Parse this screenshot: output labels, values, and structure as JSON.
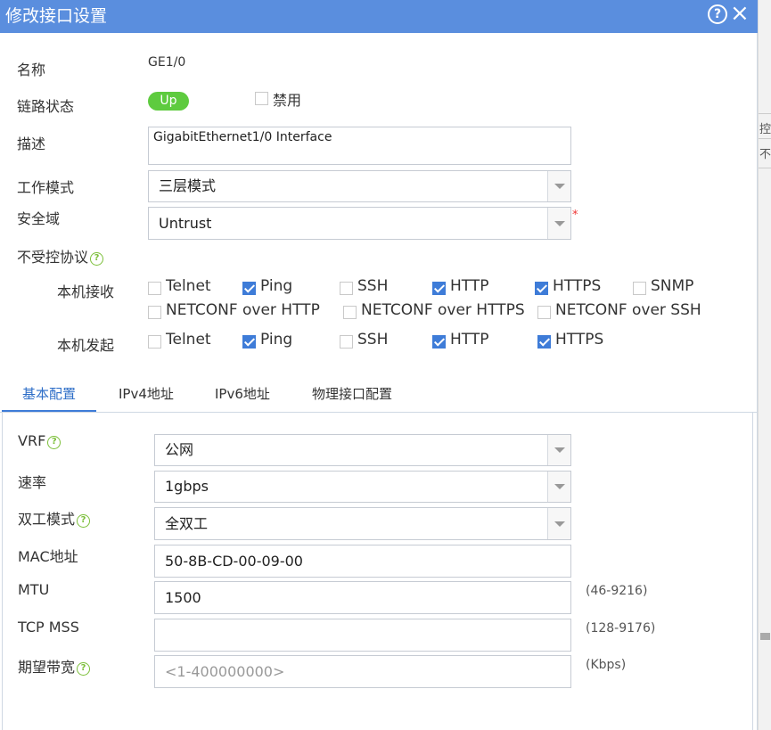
{
  "dialog": {
    "title": "修改接口设置",
    "help_icon": "question-circle-icon",
    "close_icon": "close-icon"
  },
  "background": {
    "fragment1": "控制",
    "fragment2": "不"
  },
  "form": {
    "name_label": "名称",
    "name_value": "GE1/0",
    "link_status_label": "链路状态",
    "link_status_value": "Up",
    "disable_label": "禁用",
    "disable_checked": false,
    "desc_label": "描述",
    "desc_value": "GigabitEthernet1/0 Interface",
    "work_mode_label": "工作模式",
    "work_mode_value": "三层模式",
    "security_zone_label": "安全域",
    "security_zone_value": "Untrust",
    "required_mark": "*",
    "uncontrolled_label": "不受控协议",
    "local_receive_label": "本机接收",
    "local_send_label": "本机发起",
    "receive": [
      {
        "label": "Telnet",
        "checked": false
      },
      {
        "label": "Ping",
        "checked": true
      },
      {
        "label": "SSH",
        "checked": false
      },
      {
        "label": "HTTP",
        "checked": true
      },
      {
        "label": "HTTPS",
        "checked": true
      },
      {
        "label": "SNMP",
        "checked": false
      },
      {
        "label": "NETCONF over HTTP",
        "checked": false
      },
      {
        "label": "NETCONF over HTTPS",
        "checked": false
      },
      {
        "label": "NETCONF over SSH",
        "checked": false
      }
    ],
    "send": [
      {
        "label": "Telnet",
        "checked": false
      },
      {
        "label": "Ping",
        "checked": true
      },
      {
        "label": "SSH",
        "checked": false
      },
      {
        "label": "HTTP",
        "checked": true
      },
      {
        "label": "HTTPS",
        "checked": true
      }
    ]
  },
  "tabs": [
    {
      "label": "基本配置",
      "active": true
    },
    {
      "label": "IPv4地址",
      "active": false
    },
    {
      "label": "IPv6地址",
      "active": false
    },
    {
      "label": "物理接口配置",
      "active": false
    }
  ],
  "basic": {
    "vrf_label": "VRF",
    "vrf_value": "公网",
    "rate_label": "速率",
    "rate_value": "1gbps",
    "duplex_label": "双工模式",
    "duplex_value": "全双工",
    "mac_label": "MAC地址",
    "mac_value": "50-8B-CD-00-09-00",
    "mtu_label": "MTU",
    "mtu_value": "1500",
    "mtu_hint": "(46-9216)",
    "tcpmss_label": "TCP MSS",
    "tcpmss_value": "",
    "tcpmss_hint": "(128-9176)",
    "bandwidth_label": "期望带宽",
    "bandwidth_placeholder": "<1-400000000>",
    "bandwidth_hint": "(Kbps)"
  },
  "colors": {
    "titlebar": "#5a8ede",
    "accent": "#3e7cd8",
    "status_up": "#5ecb3f",
    "help_green": "#7cbf3a"
  }
}
